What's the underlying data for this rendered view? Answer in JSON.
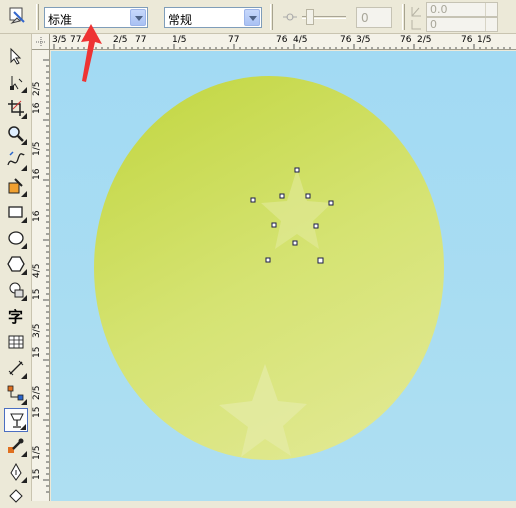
{
  "propbar": {
    "style_combo": {
      "value": "标准"
    },
    "mode_combo": {
      "value": "常规"
    },
    "slider_value": "0",
    "offset_x": "0.0",
    "offset_y": "0"
  },
  "toolbox": {
    "tools": [
      {
        "name": "pick-tool",
        "icon": "arrow-pointer-icon"
      },
      {
        "name": "shape-tool",
        "icon": "shape-node-icon"
      },
      {
        "name": "crop-tool",
        "icon": "crop-icon"
      },
      {
        "name": "zoom-tool",
        "icon": "magnifier-icon"
      },
      {
        "name": "freehand-tool",
        "icon": "freehand-curve-icon"
      },
      {
        "name": "smart-fill-tool",
        "icon": "smart-fill-icon"
      },
      {
        "name": "rectangle-tool",
        "icon": "rectangle-icon"
      },
      {
        "name": "ellipse-tool",
        "icon": "ellipse-icon"
      },
      {
        "name": "polygon-tool",
        "icon": "polygon-icon"
      },
      {
        "name": "basic-shapes-tool",
        "icon": "basic-shapes-icon"
      },
      {
        "name": "text-tool",
        "icon": "text-character-icon",
        "glyph": "字"
      },
      {
        "name": "table-tool",
        "icon": "table-grid-icon"
      },
      {
        "name": "dimension-tool",
        "icon": "dimension-ruler-icon"
      },
      {
        "name": "connector-tool",
        "icon": "connector-icon"
      },
      {
        "name": "transparency-tool",
        "icon": "wine-glass-icon",
        "active": true
      },
      {
        "name": "eyedropper-tool",
        "icon": "eyedropper-icon"
      },
      {
        "name": "outline-pen-tool",
        "icon": "pen-nib-icon"
      },
      {
        "name": "fill-tool",
        "icon": "paint-bucket-icon"
      }
    ]
  },
  "ruler": {
    "horizontal": [
      "3/5",
      "77",
      "2/5",
      "77",
      "1/5",
      "77",
      "76",
      "4/5",
      "76",
      "3/5",
      "76",
      "2/5",
      "76",
      "1/5"
    ],
    "vertical": [
      "2/5",
      "16",
      "1/5",
      "16",
      "16",
      "4/5",
      "15",
      "3/5",
      "15",
      "2/5",
      "15",
      "1/5",
      "15"
    ]
  },
  "colors": {
    "canvas": "#a6dcf3",
    "ellipse_light": "#dfe68a",
    "ellipse_dark": "#c4d84c",
    "star_fill": "#e4eba0",
    "annotation_arrow": "#ee3333"
  }
}
